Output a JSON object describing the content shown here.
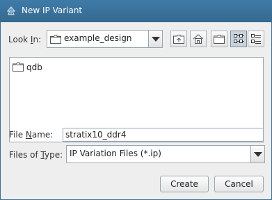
{
  "window": {
    "title": "New IP Variant"
  },
  "look_in": {
    "label": "Look In:",
    "value": "example_design"
  },
  "toolbar": {
    "buttons": [
      "up-one-level",
      "home",
      "new-folder",
      "list-view",
      "details-view"
    ]
  },
  "files": [
    {
      "name": "qdb",
      "type": "folder"
    }
  ],
  "file_name": {
    "label": "File Name:",
    "value": "stratix10_ddr4"
  },
  "files_of_type": {
    "label": "Files of Type:",
    "value": "IP Variation Files (*.ip)"
  },
  "actions": {
    "create": "Create",
    "cancel": "Cancel"
  }
}
